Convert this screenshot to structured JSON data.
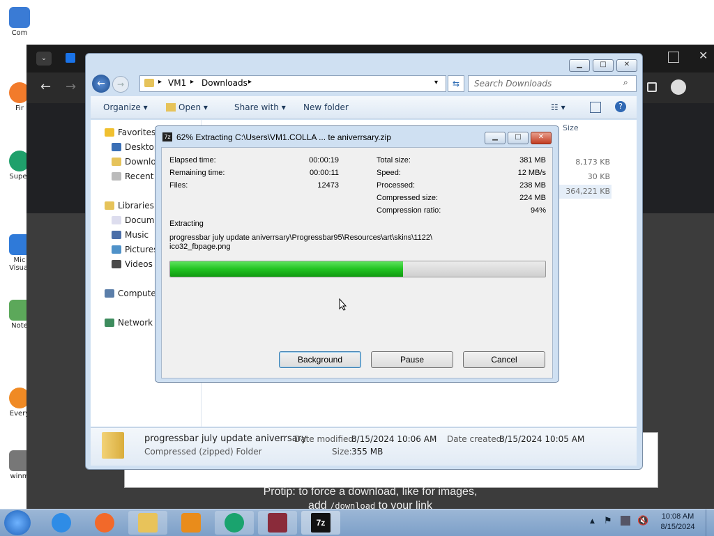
{
  "desktop": {
    "icons": [
      "Com",
      "Fir",
      "Super",
      "Mic\nVisual",
      "Note",
      "Every",
      "winm"
    ]
  },
  "browser": {
    "protip_line1": "Protip: to force a download, like for images,",
    "protip_line2a": "add ",
    "protip_code": "/download",
    "protip_line2b": " to your link"
  },
  "explorer": {
    "breadcrumb": [
      "VM1",
      "Downloads"
    ],
    "search_placeholder": "Search Downloads",
    "toolbar": {
      "organize": "Organize",
      "open": "Open",
      "share_with": "Share with",
      "new_folder": "New folder"
    },
    "column_size": "Size",
    "sizes": [
      "8,173 KB",
      "30 KB",
      "364,221 KB"
    ],
    "sidebar": {
      "favorites": "Favorites",
      "desktop": "Desktop",
      "downloads": "Downloads",
      "recent": "Recent Places",
      "libraries": "Libraries",
      "documents": "Documents",
      "music": "Music",
      "pictures": "Pictures",
      "videos": "Videos",
      "computer": "Computer",
      "network": "Network"
    },
    "details": {
      "name": "progressbar july update aniverrsary",
      "type": "Compressed (zipped) Folder",
      "date_modified_label": "Date modified:",
      "date_modified": "8/15/2024 10:06 AM",
      "date_created_label": "Date created:",
      "date_created": "8/15/2024 10:05 AM",
      "size_label": "Size:",
      "size": "355 MB"
    }
  },
  "dialog": {
    "title": "62% Extracting C:\\Users\\VM1.COLLA ... te aniverrsary.zip",
    "elapsed_label": "Elapsed time:",
    "elapsed": "00:00:19",
    "remaining_label": "Remaining time:",
    "remaining": "00:00:11",
    "files_label": "Files:",
    "files": "12473",
    "total_size_label": "Total size:",
    "total_size": "381 MB",
    "speed_label": "Speed:",
    "speed": "12 MB/s",
    "processed_label": "Processed:",
    "processed": "238 MB",
    "compressed_label": "Compressed size:",
    "compressed": "224 MB",
    "ratio_label": "Compression ratio:",
    "ratio": "94%",
    "status": "Extracting",
    "path_line1": "progressbar july update aniverrsary\\Progressbar95\\Resources\\art\\skins\\1122\\",
    "path_line2": "ico32_fbpage.png",
    "progress_fraction": 0.62,
    "progress_color": "#22c322",
    "buttons": {
      "background": "Background",
      "pause": "Pause",
      "cancel": "Cancel"
    }
  },
  "taskbar": {
    "time": "10:08 AM",
    "date": "8/15/2024"
  }
}
